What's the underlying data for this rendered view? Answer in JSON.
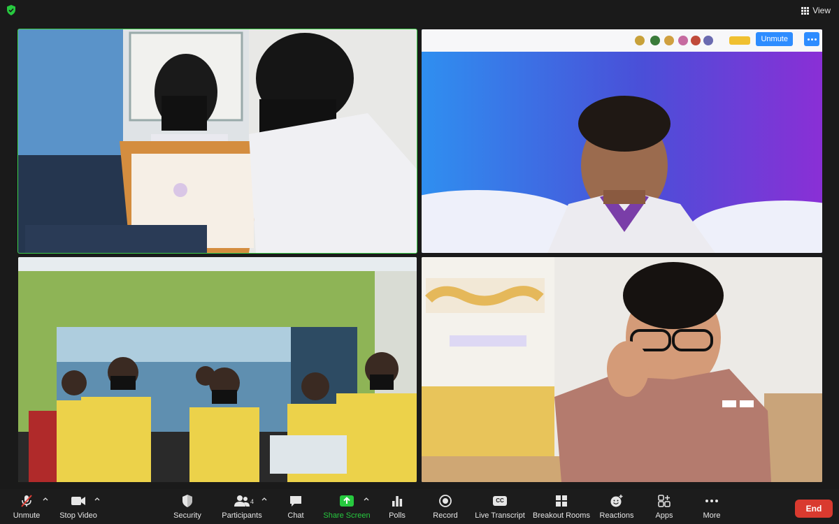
{
  "top_bar": {
    "view_label": "View"
  },
  "tiles": {
    "speaker_2": {
      "unmute_label": "Unmute"
    }
  },
  "toolbar": {
    "unmute": "Unmute",
    "stop_video": "Stop Video",
    "security": "Security",
    "participants": "Participants",
    "participants_count": "4",
    "chat": "Chat",
    "share_screen": "Share Screen",
    "polls": "Polls",
    "record": "Record",
    "live_transcript": "Live Transcript",
    "live_transcript_icon_text": "CC",
    "breakout_rooms": "Breakout Rooms",
    "reactions": "Reactions",
    "apps": "Apps",
    "more": "More",
    "end": "End"
  },
  "colors": {
    "active_speaker_border": "#3ecf4a",
    "share_green": "#27c93f",
    "accent_blue": "#2d8cff",
    "end_red": "#d93a2f"
  }
}
